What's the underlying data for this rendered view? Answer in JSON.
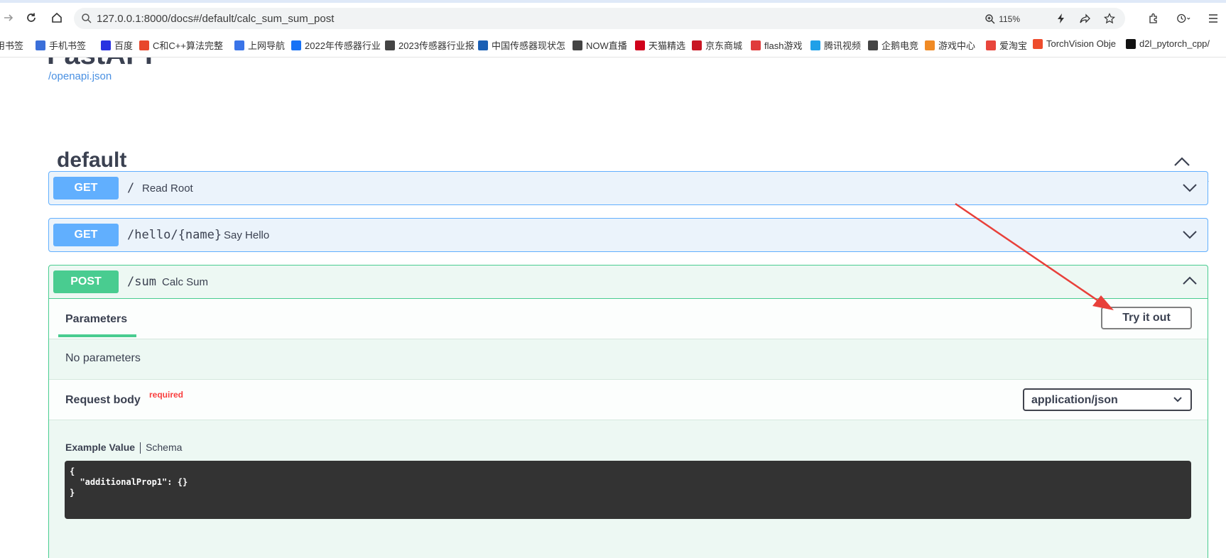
{
  "browser": {
    "url": "127.0.0.1:8000/docs#/default/calc_sum_sum_post",
    "zoom": "115%",
    "bookmarks": [
      {
        "label": "用书签",
        "color": "#888888",
        "icon": "folder-icon"
      },
      {
        "label": "手机书签",
        "color": "#3b6fd9",
        "icon": "phone-icon"
      },
      {
        "label": "百度",
        "color": "#2932e1",
        "icon": "baidu-icon"
      },
      {
        "label": "C和C++算法完整",
        "color": "#e8472c",
        "icon": "c-icon"
      },
      {
        "label": "上网导航",
        "color": "#3a74e8",
        "icon": "nav-icon"
      },
      {
        "label": "2022年传感器行业",
        "color": "#1772f6",
        "icon": "zhihu-icon"
      },
      {
        "label": "2023传感器行业报",
        "color": "#444444",
        "icon": "globe-icon"
      },
      {
        "label": "中国传感器现状怎",
        "color": "#1a5fb4",
        "icon": "sogou-icon"
      },
      {
        "label": "NOW直播",
        "color": "#444444",
        "icon": "globe-icon"
      },
      {
        "label": "天猫精选",
        "color": "#d0021b",
        "icon": "tmall-icon"
      },
      {
        "label": "京东商城",
        "color": "#c81623",
        "icon": "jd-icon"
      },
      {
        "label": "flash游戏",
        "color": "#e03a3a",
        "icon": "flash-icon"
      },
      {
        "label": "腾讯视频",
        "color": "#20a0e8",
        "icon": "video-icon"
      },
      {
        "label": "企鹅电竞",
        "color": "#444444",
        "icon": "globe-icon"
      },
      {
        "label": "游戏中心",
        "color": "#f08a24",
        "icon": "game-icon"
      },
      {
        "label": "爱淘宝",
        "color": "#e8453c",
        "icon": "taobao-icon"
      },
      {
        "label": "TorchVision Obje",
        "color": "#ee4c2c",
        "icon": "pytorch-icon"
      },
      {
        "label": "d2l_pytorch_cpp/",
        "color": "#111111",
        "icon": "github-icon"
      }
    ]
  },
  "page": {
    "openapi_link": "/openapi.json",
    "tag": "default",
    "operations": [
      {
        "method": "GET",
        "path": "/",
        "summary": "Read Root"
      },
      {
        "method": "GET",
        "path": "/hello/{name}",
        "summary": "Say Hello"
      },
      {
        "method": "POST",
        "path": "/sum",
        "summary": "Calc Sum"
      }
    ],
    "expanded": {
      "parameters_tab": "Parameters",
      "try_button": "Try it out",
      "no_params": "No parameters",
      "request_body_label": "Request body",
      "required_label": "required",
      "content_type": "application/json",
      "example_tab": "Example Value",
      "schema_tab": "Schema",
      "code_lines": [
        "{",
        "  \"additionalProp1\": {}",
        "}"
      ]
    }
  },
  "colors": {
    "get": "#61affe",
    "post": "#49cc90",
    "annotation_arrow": "#e8403a"
  }
}
